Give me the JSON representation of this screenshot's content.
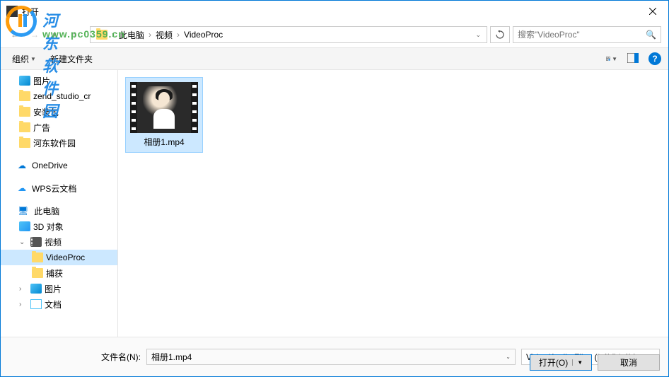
{
  "title": "打开",
  "breadcrumb": {
    "items": [
      "此电脑",
      "视频",
      "VideoProc"
    ]
  },
  "search": {
    "placeholder": "搜索\"VideoProc\""
  },
  "toolbar": {
    "organize": "组织",
    "new_folder": "新建文件夹"
  },
  "sidebar": {
    "items": [
      {
        "label": "图片",
        "icon": "pictures"
      },
      {
        "label": "zend_studio_cr",
        "icon": "folder"
      },
      {
        "label": "安装包",
        "icon": "folder"
      },
      {
        "label": "广告",
        "icon": "folder"
      },
      {
        "label": "河东软件园",
        "icon": "folder"
      },
      {
        "label": "OneDrive",
        "icon": "onedrive"
      },
      {
        "label": "WPS云文档",
        "icon": "wps"
      },
      {
        "label": "此电脑",
        "icon": "pc"
      },
      {
        "label": "3D 对象",
        "icon": "3d"
      },
      {
        "label": "视频",
        "icon": "video"
      },
      {
        "label": "VideoProc",
        "icon": "folder"
      },
      {
        "label": "捕获",
        "icon": "folder"
      },
      {
        "label": "图片",
        "icon": "pictures"
      },
      {
        "label": "文档",
        "icon": "docs"
      }
    ]
  },
  "files": [
    {
      "name": "相册1.mp4",
      "selected": true
    }
  ],
  "footer": {
    "filename_label": "文件名(N):",
    "filename_value": "相册1.mp4",
    "filetype": "Video/Audio Files (*.AVI;*.AV",
    "open": "打开(O)",
    "cancel": "取消"
  },
  "watermark": {
    "text": "河东软件园",
    "url": "www.pc0359.cn"
  }
}
